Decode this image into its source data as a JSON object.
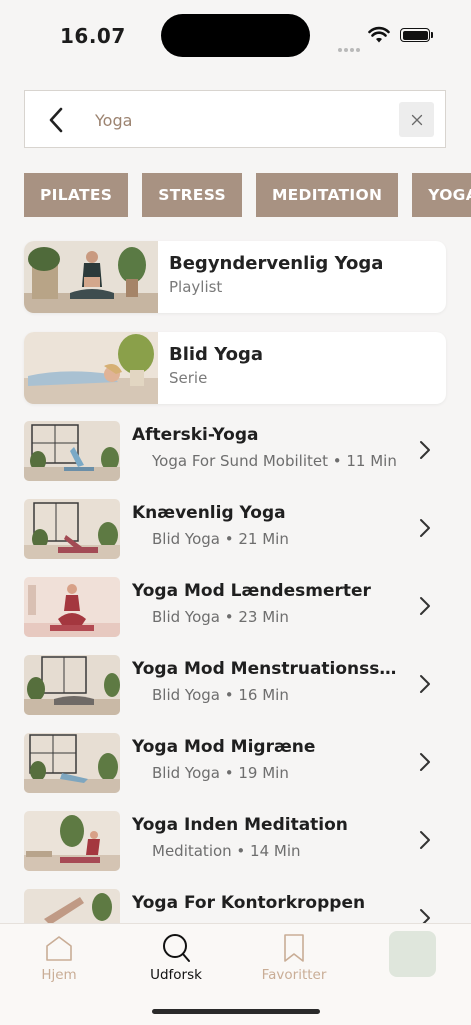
{
  "status_bar": {
    "time": "16.07"
  },
  "search": {
    "value": "Yoga"
  },
  "chips": [
    "PILATES",
    "STRESS",
    "MEDITATION",
    "YOGA"
  ],
  "featured": [
    {
      "title": "Begyndervenlig Yoga",
      "subtitle": "Playlist"
    },
    {
      "title": "Blid Yoga",
      "subtitle": "Serie"
    }
  ],
  "sessions": [
    {
      "title": "Afterski-Yoga",
      "subtitle": "Yoga For Sund Mobilitet • 11 Min"
    },
    {
      "title": "Knævenlig Yoga",
      "subtitle": "Blid Yoga • 21 Min"
    },
    {
      "title": "Yoga Mod Lændesmerter",
      "subtitle": "Blid Yoga • 23 Min"
    },
    {
      "title": "Yoga Mod Menstruationssmert…",
      "subtitle": "Blid Yoga • 16 Min"
    },
    {
      "title": "Yoga Mod Migræne",
      "subtitle": "Blid Yoga • 19 Min"
    },
    {
      "title": "Yoga Inden Meditation",
      "subtitle": "Meditation • 14 Min"
    },
    {
      "title": "Yoga For Kontorkroppen",
      "subtitle": ""
    }
  ],
  "tabbar": {
    "home": "Hjem",
    "explore": "Udforsk",
    "favorites": "Favoritter"
  },
  "icons": {
    "back": "chevron-left-icon",
    "clear": "close-icon",
    "row": "chevron-right-icon",
    "home": "house-icon",
    "explore": "search-icon",
    "favorites": "bookmark-icon"
  },
  "colors": {
    "accent": "#a89282",
    "tab_inactive": "#c9ad96",
    "search_text": "#9c8370",
    "extra_tab": "#dfe6dc"
  }
}
